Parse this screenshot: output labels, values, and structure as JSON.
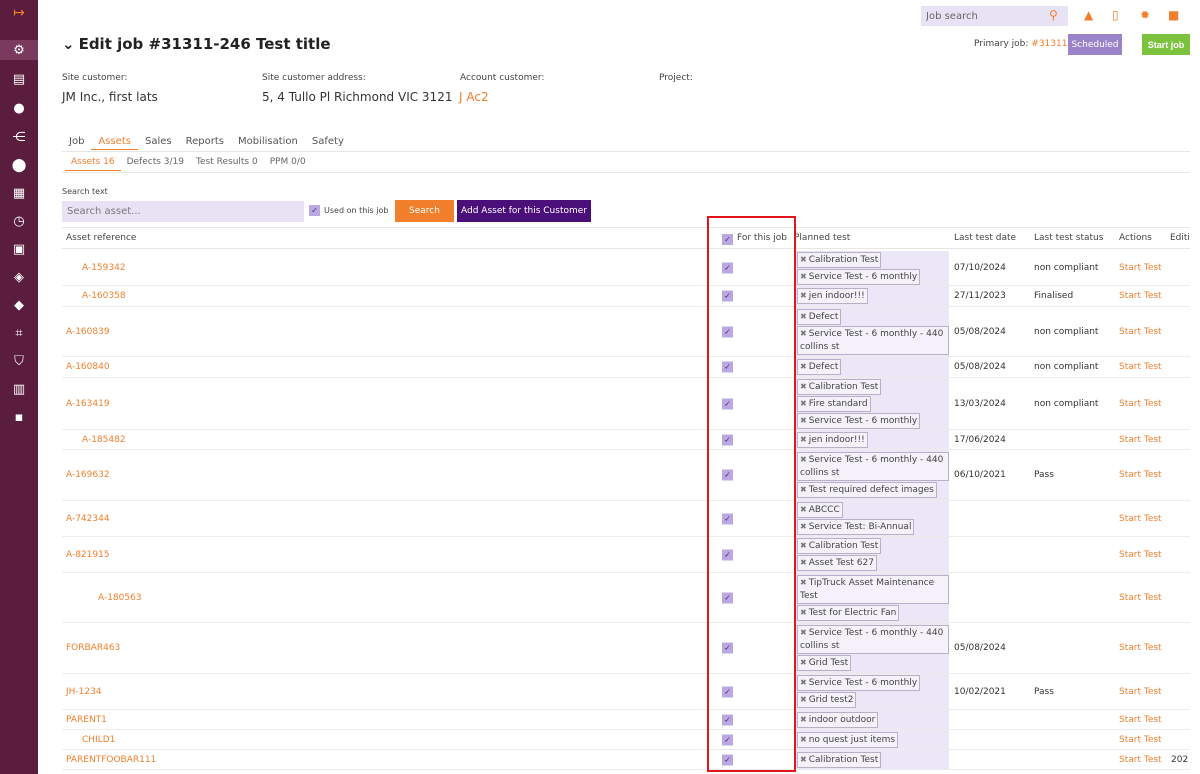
{
  "sidebar": {
    "icons": [
      "exit-icon",
      "wrench-icon",
      "document-icon",
      "person-icon",
      "hierarchy-icon",
      "location-pin-icon",
      "map-icon",
      "clock-icon",
      "clipboard-icon",
      "cube-icon",
      "tag-icon",
      "scan-icon",
      "shield-icon",
      "book-icon",
      "chat-icon"
    ],
    "active": "wrench-icon"
  },
  "topbar": {
    "search_placeholder": "Job search",
    "icons": [
      "search-icon",
      "bell-icon",
      "mobile-icon",
      "gear-icon",
      "bookmark-icon"
    ]
  },
  "header": {
    "title": "Edit job #31311-246 Test title",
    "primary_job_label": "Primary job:",
    "primary_job_link": "#31311",
    "status_badge": "Scheduled",
    "start_job_label": "Start job"
  },
  "info": {
    "site_customer_label": "Site customer:",
    "site_customer_value": "JM Inc., first lats",
    "site_address_label": "Site customer address:",
    "site_address_value": "5, 4 Tullo Pl Richmond VIC 3121",
    "account_customer_label": "Account customer:",
    "account_customer_value": "J Ac2",
    "project_label": "Project:"
  },
  "tabs": [
    "Job",
    "Assets",
    "Sales",
    "Reports",
    "Mobilisation",
    "Safety"
  ],
  "active_tab": "Assets",
  "subtabs": [
    "Assets 16",
    "Defects 3/19",
    "Test Results 0",
    "PPM 0/0"
  ],
  "active_subtab": "Assets 16",
  "search": {
    "label": "Search text",
    "placeholder": "Search asset...",
    "used_on_job_label": "Used on this job",
    "search_button": "Search",
    "add_button": "Add Asset for this Customer"
  },
  "table": {
    "columns": {
      "asset_reference": "Asset reference",
      "for_this_job": "For this job",
      "planned_test": "Planned test",
      "last_test_date": "Last test date",
      "last_test_status": "Last test status",
      "actions": "Actions",
      "extra": "Editi"
    },
    "rows": [
      {
        "ref": "A-159342",
        "indent": 1,
        "tests": [
          "Calibration Test",
          "Service Test - 6 monthly"
        ],
        "date": "07/10/2024",
        "status": "non compliant",
        "action": "Start Test",
        "extra": ""
      },
      {
        "ref": "A-160358",
        "indent": 1,
        "tests": [
          "jen indoor!!!"
        ],
        "date": "27/11/2023",
        "status": "Finalised",
        "action": "Start Test",
        "extra": ""
      },
      {
        "ref": "A-160839",
        "indent": 0,
        "tests": [
          "Defect",
          "Service Test - 6 monthly - 440 collins st"
        ],
        "date": "05/08/2024",
        "status": "non compliant",
        "action": "Start Test",
        "extra": ""
      },
      {
        "ref": "A-160840",
        "indent": 0,
        "tests": [
          "Defect"
        ],
        "date": "05/08/2024",
        "status": "non compliant",
        "action": "Start Test",
        "extra": ""
      },
      {
        "ref": "A-163419",
        "indent": 0,
        "tests": [
          "Calibration Test",
          "Fire standard",
          "Service Test - 6 monthly"
        ],
        "date": "13/03/2024",
        "status": "non compliant",
        "action": "Start Test",
        "extra": ""
      },
      {
        "ref": "A-185482",
        "indent": 1,
        "tests": [
          "jen indoor!!!"
        ],
        "date": "17/06/2024",
        "status": "",
        "action": "Start Test",
        "extra": ""
      },
      {
        "ref": "A-169632",
        "indent": 0,
        "tests": [
          "Service Test - 6 monthly - 440 collins st",
          "Test required defect images"
        ],
        "date": "06/10/2021",
        "status": "Pass",
        "action": "Start Test",
        "extra": ""
      },
      {
        "ref": "A-742344",
        "indent": 0,
        "tests": [
          "ABCCC",
          "Service Test: Bi-Annual"
        ],
        "date": "",
        "status": "",
        "action": "Start Test",
        "extra": ""
      },
      {
        "ref": "A-821915",
        "indent": 0,
        "tests": [
          "Calibration Test",
          "Asset Test 627"
        ],
        "date": "",
        "status": "",
        "action": "Start Test",
        "extra": ""
      },
      {
        "ref": "A-180563",
        "indent": 2,
        "tests": [
          "TipTruck Asset Maintenance Test",
          "Test for Electric Fan"
        ],
        "date": "",
        "status": "",
        "action": "Start Test",
        "extra": ""
      },
      {
        "ref": "FORBAR463",
        "indent": 0,
        "tests": [
          "Service Test - 6 monthly - 440 collins st",
          "Grid Test"
        ],
        "date": "05/08/2024",
        "status": "",
        "action": "Start Test",
        "extra": ""
      },
      {
        "ref": "JH-1234",
        "indent": 0,
        "tests": [
          "Service Test - 6 monthly",
          "Grid test2"
        ],
        "date": "10/02/2021",
        "status": "Pass",
        "action": "Start Test",
        "extra": ""
      },
      {
        "ref": "PARENT1",
        "indent": 0,
        "tests": [
          "indoor outdoor"
        ],
        "date": "",
        "status": "",
        "action": "Start Test",
        "extra": ""
      },
      {
        "ref": "CHILD1",
        "indent": 1,
        "tests": [
          "no quest just items"
        ],
        "date": "",
        "status": "",
        "action": "Start Test",
        "extra": ""
      },
      {
        "ref": "PARENTFOOBAR111",
        "indent": 0,
        "tests": [
          "Calibration Test"
        ],
        "date": "",
        "status": "",
        "action": "Start Test",
        "extra": "202"
      }
    ]
  },
  "colors": {
    "sidebar": "#5a1d3e",
    "accent": "#f27f2b",
    "purple_button": "#4b0f7a",
    "scheduled_badge": "#9b83c9",
    "start_job": "#7cc23c",
    "highlight_box": "#e0161b"
  }
}
